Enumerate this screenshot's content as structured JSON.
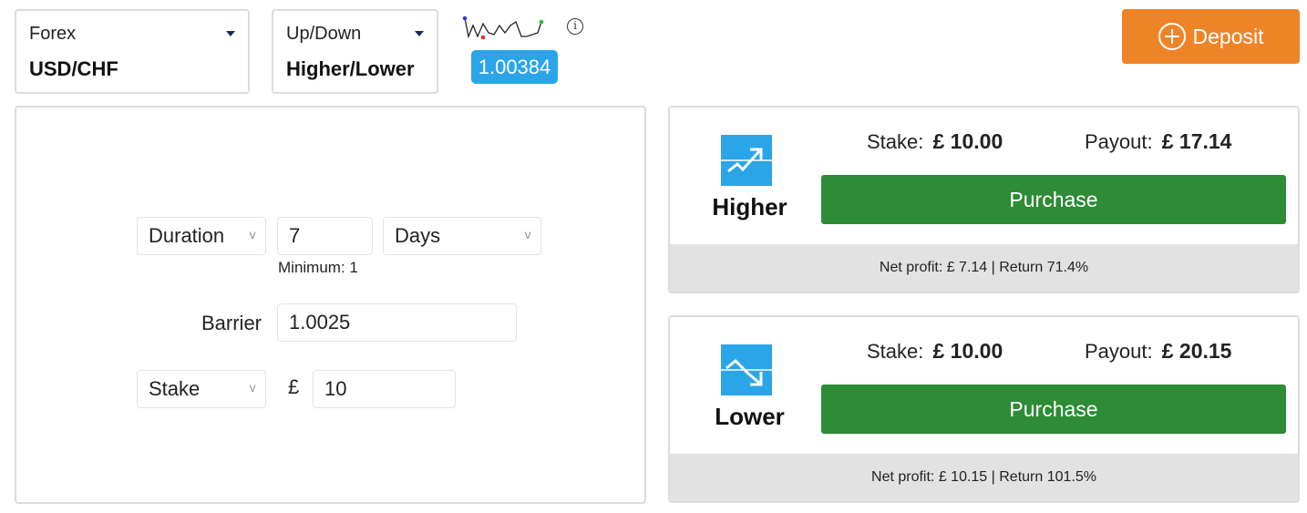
{
  "market_selector": {
    "category": "Forex",
    "value": "USD/CHF"
  },
  "type_selector": {
    "category": "Up/Down",
    "value": "Higher/Lower"
  },
  "ticker": {
    "price": "1.00384",
    "info_symbol": "i",
    "badge_color": "#2aa5e8"
  },
  "deposit": {
    "label": "Deposit",
    "color": "#ee8428"
  },
  "form": {
    "duration_select": "Duration",
    "duration_value": "7",
    "duration_unit": "Days",
    "duration_hint": "Minimum: 1",
    "barrier_label": "Barrier",
    "barrier_value": "1.0025",
    "stake_select": "Stake",
    "currency_symbol": "£",
    "stake_value": "10",
    "chevron": "v"
  },
  "contracts": [
    {
      "name": "Higher",
      "icon": "trend-up-icon",
      "stake_label": "Stake:",
      "stake_amount": "£ 10.00",
      "payout_label": "Payout:",
      "payout_amount": "£ 17.14",
      "purchase_label": "Purchase",
      "footer": "Net profit: £ 7.14 | Return 71.4%"
    },
    {
      "name": "Lower",
      "icon": "trend-down-icon",
      "stake_label": "Stake:",
      "stake_amount": "£ 10.00",
      "payout_label": "Payout:",
      "payout_amount": "£ 20.15",
      "purchase_label": "Purchase",
      "footer": "Net profit: £ 10.15 | Return 101.5%"
    }
  ],
  "colors": {
    "purchase": "#2e8b36",
    "icon_bg": "#2aa5e8",
    "footer_bg": "#e2e2e2"
  }
}
